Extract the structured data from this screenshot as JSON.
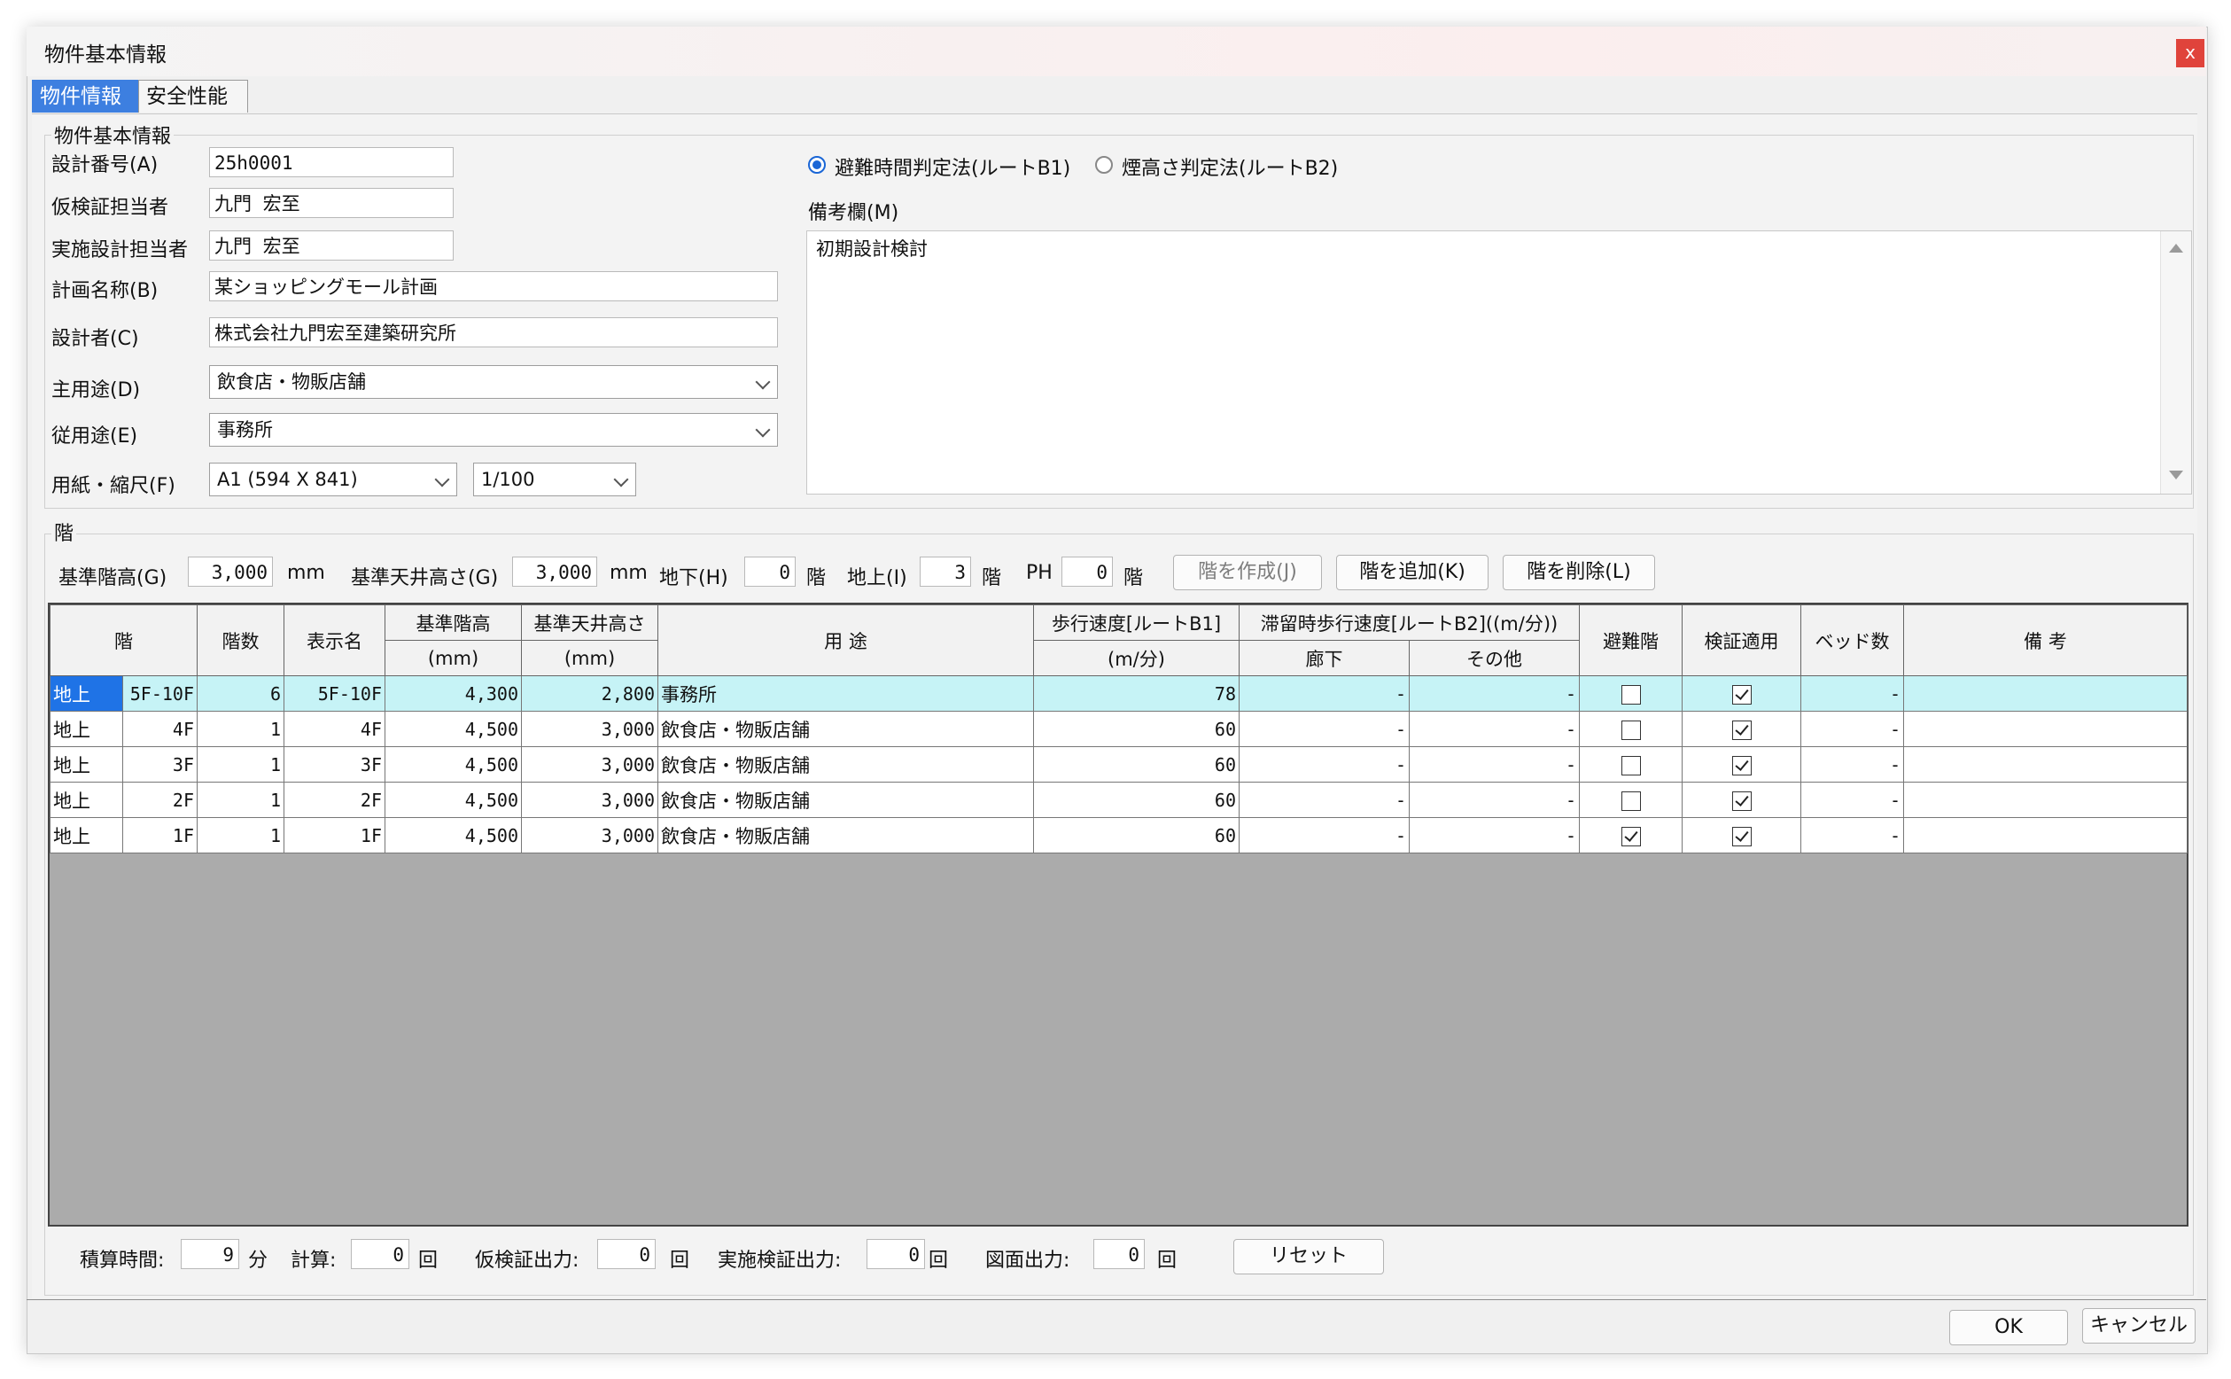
{
  "window": {
    "title": "物件基本情報",
    "close": "x"
  },
  "tabs": [
    {
      "label": "物件情報",
      "active": true
    },
    {
      "label": "安全性能",
      "active": false
    }
  ],
  "basic": {
    "group_title": "物件基本情報",
    "design_no": {
      "label": "設計番号(A)",
      "value": "25h0001"
    },
    "temp_checker": {
      "label": "仮検証担当者",
      "value": "九門 宏至"
    },
    "impl_designer": {
      "label": "実施設計担当者",
      "value": "九門 宏至"
    },
    "plan_name": {
      "label": "計画名称(B)",
      "value": "某ショッピングモール計画"
    },
    "designer": {
      "label": "設計者(C)",
      "value": "株式会社九門宏至建築研究所"
    },
    "main_use": {
      "label": "主用途(D)",
      "value": "飲食店・物販店舗"
    },
    "sub_use": {
      "label": "従用途(E)",
      "value": "事務所"
    },
    "paper": {
      "label": "用紙・縮尺(F)",
      "value": "A1 (594 X 841)",
      "scale": "1/100"
    },
    "route_b1": "避難時間判定法(ルートB1)",
    "route_b2": "煙高さ判定法(ルートB2)",
    "route_selected": "B1",
    "notes_label": "備考欄(M)",
    "notes_value": "初期設計検討"
  },
  "floors": {
    "group_title": "階",
    "std_height_label": "基準階高(G)",
    "std_height": "3,000",
    "unit_mm": "mm",
    "std_ceiling_label": "基準天井高さ(G)",
    "std_ceiling": "3,000",
    "unit_mm2": "mm",
    "basement_label": "地下(H)",
    "basement": "0",
    "kai1": "階",
    "above_label": "地上(I)",
    "above": "3",
    "kai2": "階",
    "ph_label": "PH",
    "ph": "0",
    "kai3": "階",
    "btn_create": "階を作成(J)",
    "btn_add": "階を追加(K)",
    "btn_delete": "階を削除(L)"
  },
  "table": {
    "headers": {
      "floor": "階",
      "count": "階数",
      "display": "表示名",
      "std_h": "基準階高",
      "std_h_unit": "(mm)",
      "ceil": "基準天井高さ",
      "ceil_unit": "(mm)",
      "use": "用 途",
      "walk": "歩行速度[ルートB1]",
      "walk_unit": "(m/分)",
      "stay": "滞留時歩行速度[ルートB2]((m/分))",
      "corridor": "廊下",
      "other": "その他",
      "evac": "避難階",
      "verify": "検証適用",
      "beds": "ベッド数",
      "remarks": "備 考"
    },
    "rows": [
      {
        "kind": "地上",
        "floor": "5F-10F",
        "count": "6",
        "display": "5F-10F",
        "std_h": "4,300",
        "ceil": "2,800",
        "use": "事務所",
        "walk": "78",
        "corridor": "-",
        "other": "-",
        "evac": false,
        "verify": true,
        "beds": "-",
        "remarks": ""
      },
      {
        "kind": "地上",
        "floor": "4F",
        "count": "1",
        "display": "4F",
        "std_h": "4,500",
        "ceil": "3,000",
        "use": "飲食店・物販店舗",
        "walk": "60",
        "corridor": "-",
        "other": "-",
        "evac": false,
        "verify": true,
        "beds": "-",
        "remarks": ""
      },
      {
        "kind": "地上",
        "floor": "3F",
        "count": "1",
        "display": "3F",
        "std_h": "4,500",
        "ceil": "3,000",
        "use": "飲食店・物販店舗",
        "walk": "60",
        "corridor": "-",
        "other": "-",
        "evac": false,
        "verify": true,
        "beds": "-",
        "remarks": ""
      },
      {
        "kind": "地上",
        "floor": "2F",
        "count": "1",
        "display": "2F",
        "std_h": "4,500",
        "ceil": "3,000",
        "use": "飲食店・物販店舗",
        "walk": "60",
        "corridor": "-",
        "other": "-",
        "evac": false,
        "verify": true,
        "beds": "-",
        "remarks": ""
      },
      {
        "kind": "地上",
        "floor": "1F",
        "count": "1",
        "display": "1F",
        "std_h": "4,500",
        "ceil": "3,000",
        "use": "飲食店・物販店舗",
        "walk": "60",
        "corridor": "-",
        "other": "-",
        "evac": true,
        "verify": true,
        "beds": "-",
        "remarks": ""
      }
    ]
  },
  "stats": {
    "calc_time_label": "積算時間:",
    "calc_time": "9",
    "min": "分",
    "calc_label": "計算:",
    "calc": "0",
    "kai_a": "回",
    "temp_out_label": "仮検証出力:",
    "temp_out": "0",
    "kai_b": "回",
    "impl_out_label": "実施検証出力:",
    "impl_out": "0",
    "kai_c": "回",
    "draw_out_label": "図面出力:",
    "draw_out": "0",
    "kai_d": "回",
    "reset": "リセット"
  },
  "footer": {
    "ok": "OK",
    "cancel": "キャンセル"
  }
}
